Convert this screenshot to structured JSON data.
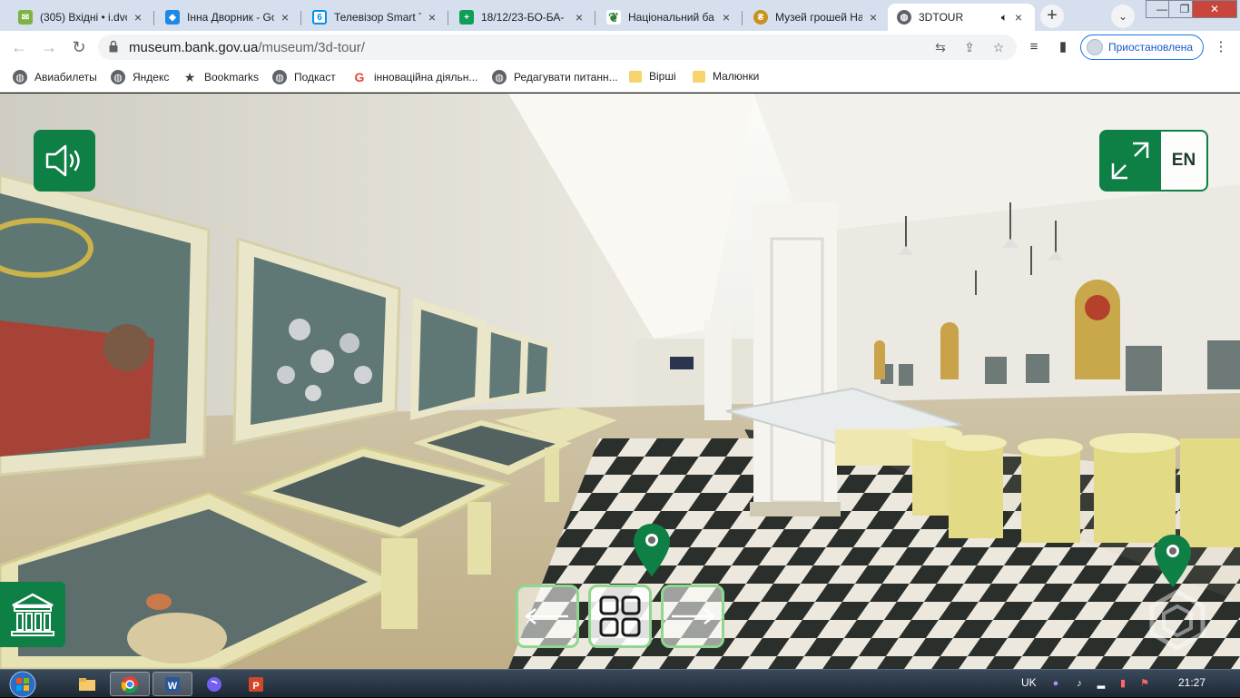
{
  "browser": {
    "tabs": [
      {
        "title": "(305) Вхідні • i.dvo",
        "favicon": "mail-icon",
        "color": "#7cb342"
      },
      {
        "title": "Інна Дворник - Go",
        "favicon": "classroom-icon",
        "color": "#1e88e5"
      },
      {
        "title": "Телевізор Smart T",
        "favicon": "shop-icon",
        "color": "#0091ea"
      },
      {
        "title": "18/12/23-БО-БА-",
        "favicon": "sheets-plus-icon",
        "color": "#0f9d58"
      },
      {
        "title": "Національний ба",
        "favicon": "bank-icon",
        "color": "#2e7d32"
      },
      {
        "title": "Музей грошей На",
        "favicon": "museum-icon",
        "color": "#c8921c"
      },
      {
        "title": "3DTOUR",
        "favicon": "globe-icon",
        "color": "#5f6368",
        "active": true
      }
    ],
    "window_controls": {
      "minimize": "—",
      "maximize": "❐",
      "close": "✕"
    },
    "new_tab": "+",
    "tab_search": "⌄"
  },
  "toolbar": {
    "url_host": "museum.bank.gov.ua",
    "url_path": "/museum/3d-tour/",
    "profile_label": "Приостановлена"
  },
  "bookmarks": [
    {
      "label": "Авиабилеты",
      "icon": "globe-icon"
    },
    {
      "label": "Яндекс",
      "icon": "globe-icon"
    },
    {
      "label": "Bookmarks",
      "icon": "star-icon"
    },
    {
      "label": "Подкаст",
      "icon": "globe-icon"
    },
    {
      "label": "інноваційна діяльн...",
      "icon": "google-icon"
    },
    {
      "label": "Редагувати питанн...",
      "icon": "globe-icon"
    },
    {
      "label": "Вірші",
      "icon": "folder-icon"
    },
    {
      "label": "Малюнки",
      "icon": "folder-icon"
    }
  ],
  "tour": {
    "language": "EN",
    "accent_color": "#0e7f45",
    "nav_highlight_color": "#8fd68e"
  },
  "taskbar": {
    "language": "UK",
    "time": "21:27",
    "apps": [
      "explorer-icon",
      "chrome-icon",
      "word-icon",
      "viber-icon",
      "powerpoint-icon"
    ]
  }
}
